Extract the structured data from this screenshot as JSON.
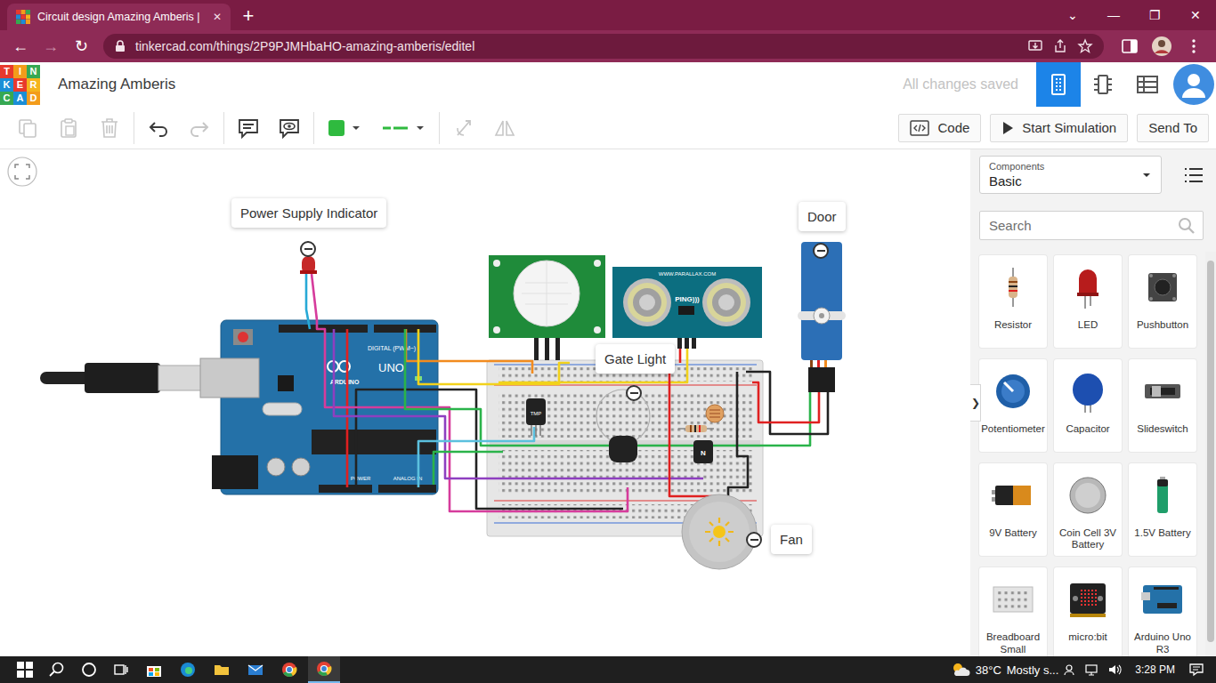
{
  "browser": {
    "tabs": [
      {
        "title": "Circuit design Amazing Amberis |",
        "close": "✕",
        "selected": true
      }
    ],
    "new_tab": "+",
    "window_controls": [
      "⌄",
      "—",
      "❐",
      "✕"
    ],
    "nav": [
      "←",
      "→",
      "↻"
    ],
    "url": "tinkercad.com/things/2P9PJMHbaHO-amazing-amberis/editel"
  },
  "header": {
    "logo": [
      {
        "letter": "T",
        "color": "#e8392d"
      },
      {
        "letter": "I",
        "color": "#f39c1b"
      },
      {
        "letter": "N",
        "color": "#36a852"
      },
      {
        "letter": "K",
        "color": "#1b8ed6"
      },
      {
        "letter": "E",
        "color": "#e8392d"
      },
      {
        "letter": "R",
        "color": "#f5b41c"
      },
      {
        "letter": "C",
        "color": "#36a852"
      },
      {
        "letter": "A",
        "color": "#1b8ed6"
      },
      {
        "letter": "D",
        "color": "#f39c1b"
      }
    ],
    "title": "Amazing Amberis",
    "save_status": "All changes saved",
    "views": [
      {
        "selected": true
      },
      {
        "selected": false
      },
      {
        "selected": false
      }
    ]
  },
  "toolbar": {
    "tools": [
      {
        "disabled": true
      },
      {
        "disabled": true
      },
      {
        "disabled": true
      },
      {
        "disabled": false
      },
      {
        "disabled": true
      },
      {
        "disabled": false
      },
      {
        "disabled": false
      },
      {
        "disabled": true
      },
      {
        "disabled": true
      }
    ],
    "fill_color": "#2fba3f",
    "line_color": "#2fba3f",
    "buttons": [
      "Code",
      "Start Simulation",
      "Send To"
    ]
  },
  "canvas": {
    "notes": [
      {
        "text": "Power Supply Indicator"
      },
      {
        "text": "Gate Light"
      },
      {
        "text": "Door"
      },
      {
        "text": "Fan"
      }
    ],
    "arduino": {
      "brand": "ARDUINO",
      "model": "UNO",
      "digital": "DIGITAL (PWM~)",
      "power": "POWER",
      "analog": "ANALOG IN"
    },
    "ping": {
      "brand": "WWW.PARALLAX.COM",
      "name": "PING)))"
    },
    "tmp_label": "TMP",
    "transistor_label": "N"
  },
  "panel": {
    "toggle": "❯",
    "dropdown": {
      "caption": "Components",
      "value": "Basic"
    },
    "search": {
      "placeholder": "Search"
    },
    "components": [
      {
        "label": "Resistor",
        "kind": "resistor"
      },
      {
        "label": "LED",
        "kind": "led"
      },
      {
        "label": "Pushbutton",
        "kind": "pushbutton"
      },
      {
        "label": "Potentiometer",
        "kind": "potentiometer"
      },
      {
        "label": "Capacitor",
        "kind": "capacitor"
      },
      {
        "label": "Slideswitch",
        "kind": "slideswitch"
      },
      {
        "label": "9V Battery",
        "kind": "battery9"
      },
      {
        "label": "Coin Cell 3V Battery",
        "kind": "coincell"
      },
      {
        "label": "1.5V Battery",
        "kind": "battery15"
      },
      {
        "label": "Breadboard Small",
        "kind": "breadboard"
      },
      {
        "label": "micro:bit",
        "kind": "microbit"
      },
      {
        "label": "Arduino Uno R3",
        "kind": "arduino"
      }
    ]
  },
  "taskbar": {
    "weather": {
      "temperature": "38°C",
      "summary": "Mostly s..."
    },
    "clock": "3:28 PM"
  }
}
